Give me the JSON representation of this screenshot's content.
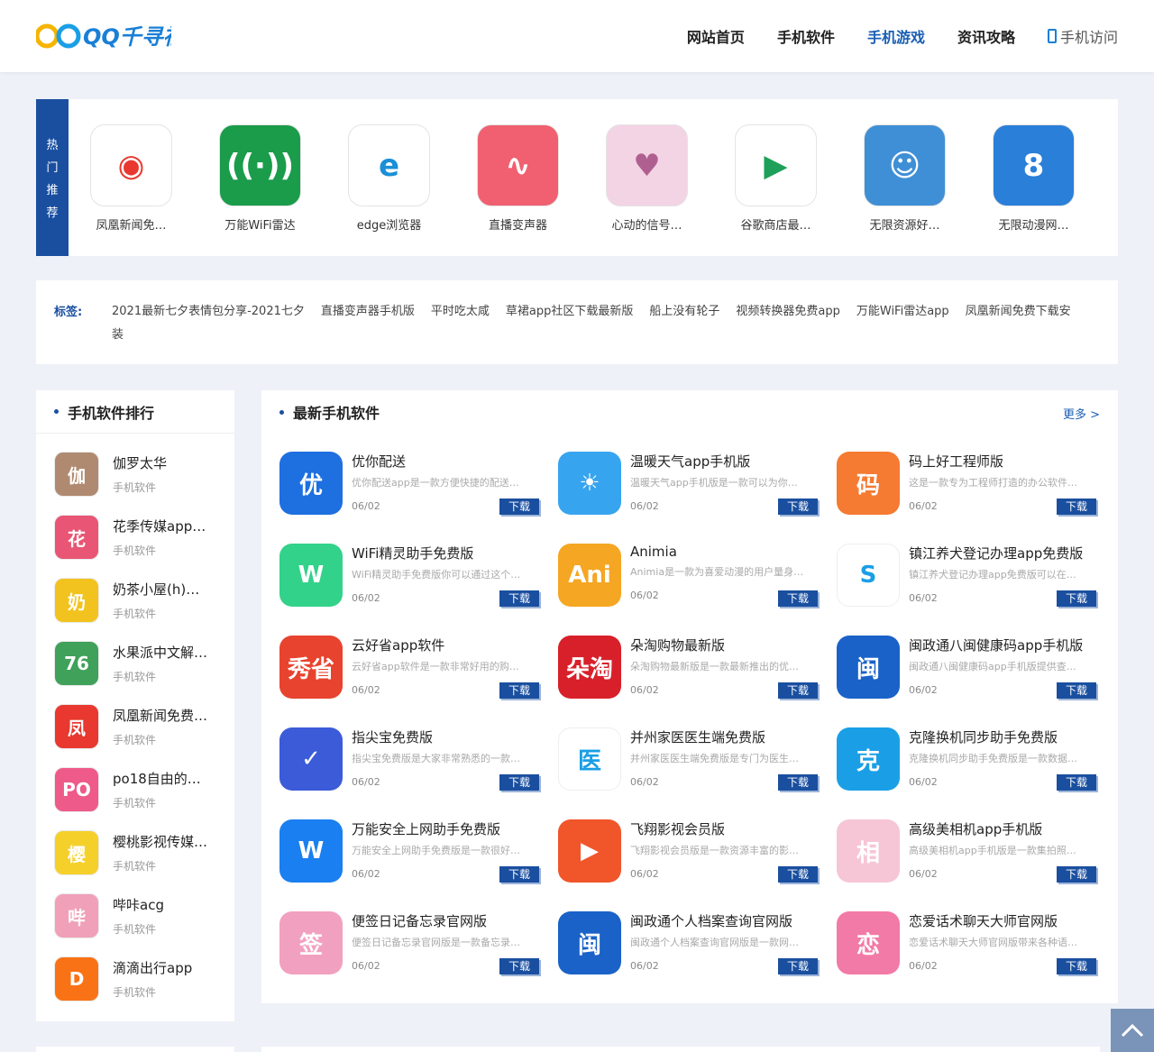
{
  "header": {
    "logo_text": "QQ千寻社区",
    "nav": [
      {
        "label": "网站首页"
      },
      {
        "label": "手机软件"
      },
      {
        "label": "手机游戏"
      },
      {
        "label": "资讯攻略"
      },
      {
        "label": "手机访问"
      }
    ]
  },
  "hot": {
    "label_chars": [
      "热",
      "门",
      "推",
      "荐"
    ],
    "items": [
      {
        "name": "凤凰新闻免…",
        "icon": "phoenix-icon",
        "color": "#ffffff"
      },
      {
        "name": "万能WiFi雷达",
        "icon": "wifi-icon",
        "color": "#1a9c4b"
      },
      {
        "name": "edge浏览器",
        "icon": "edge-icon",
        "color": "#ffffff"
      },
      {
        "name": "直播变声器",
        "icon": "voice-wave-icon",
        "color": "#f06070"
      },
      {
        "name": "心动的信号…",
        "icon": "heart-signal-icon",
        "color": "#f3d4e4"
      },
      {
        "name": "谷歌商店最…",
        "icon": "play-store-icon",
        "color": "#ffffff"
      },
      {
        "name": "无限资源好…",
        "icon": "couple-icon",
        "color": "#3f8fd6"
      },
      {
        "name": "无限动漫网…",
        "icon": "shield-8-icon",
        "color": "#2a7fd9"
      }
    ]
  },
  "tags": {
    "label": "标签:",
    "items": [
      "2021最新七夕表情包分享-2021七夕",
      "直播变声器手机版",
      "平时吃太咸",
      "草裙app社区下载最新版",
      "船上没有轮子",
      "视频转换器免费app",
      "万能WiFi雷达app",
      "凤凰新闻免费下载安装"
    ]
  },
  "rank": {
    "title": "手机软件排行",
    "items": [
      {
        "name": "伽罗太华",
        "cat": "手机软件",
        "color": "#b08a70",
        "glyph": "伽"
      },
      {
        "name": "花季传媒app…",
        "cat": "手机软件",
        "color": "#e95574",
        "glyph": "花"
      },
      {
        "name": "奶茶小屋(h)…",
        "cat": "手机软件",
        "color": "#f2c31e",
        "glyph": "奶"
      },
      {
        "name": "水果派中文解…",
        "cat": "手机软件",
        "color": "#3fa15a",
        "glyph": "76"
      },
      {
        "name": "凤凰新闻免费…",
        "cat": "手机软件",
        "color": "#e8382f",
        "glyph": "凤"
      },
      {
        "name": "po18自由的…",
        "cat": "手机软件",
        "color": "#ee5a8a",
        "glyph": "PO"
      },
      {
        "name": "樱桃影视传媒…",
        "cat": "手机软件",
        "color": "#f5d02a",
        "glyph": "樱"
      },
      {
        "name": "哔咔acg",
        "cat": "手机软件",
        "color": "#f0a0b8",
        "glyph": "哔"
      },
      {
        "name": "滴滴出行app",
        "cat": "手机软件",
        "color": "#f97316",
        "glyph": "D"
      }
    ]
  },
  "latest": {
    "title": "最新手机软件",
    "more": "更多 >",
    "download_label": "下载",
    "items": [
      {
        "name": "优你配送",
        "desc": "优你配送app是一款方便快捷的配送…",
        "date": "06/02",
        "color": "#1e6fe0",
        "glyph": "优"
      },
      {
        "name": "温暖天气app手机版",
        "desc": "温暖天气app手机版是一款可以为你…",
        "date": "06/02",
        "color": "#37a4f0",
        "glyph": "☀"
      },
      {
        "name": "码上好工程师版",
        "desc": "这是一款专为工程师打造的办公软件…",
        "date": "06/02",
        "color": "#f57a32",
        "glyph": "码"
      },
      {
        "name": "WiFi精灵助手免费版",
        "desc": "WiFi精灵助手免费版你可以通过这个…",
        "date": "06/02",
        "color": "#32d28a",
        "glyph": "W"
      },
      {
        "name": "Animia",
        "desc": "Animia是一款为喜爱动漫的用户量身…",
        "date": "06/02",
        "color": "#f5a623",
        "glyph": "Ani"
      },
      {
        "name": "镇江养犬登记办理app免费版",
        "desc": "镇江养犬登记办理app免费版可以在…",
        "date": "06/02",
        "color": "#ffffff",
        "glyph": "S"
      },
      {
        "name": "云好省app软件",
        "desc": "云好省app软件是一款非常好用的购…",
        "date": "06/02",
        "color": "#e8432e",
        "glyph": "秀省"
      },
      {
        "name": "朵淘购物最新版",
        "desc": "朵淘购物最新版是一款最新推出的优…",
        "date": "06/02",
        "color": "#d8202a",
        "glyph": "朵淘"
      },
      {
        "name": "闽政通八闽健康码app手机版",
        "desc": "闽政通八闽健康码app手机版提供查…",
        "date": "06/02",
        "color": "#1a62c8",
        "glyph": "闽"
      },
      {
        "name": "指尖宝免费版",
        "desc": "指尖宝免费版是大家非常熟悉的一款…",
        "date": "06/02",
        "color": "#3b5bd8",
        "glyph": "✓"
      },
      {
        "name": "并州家医医生端免费版",
        "desc": "并州家医医生端免费版是专门为医生…",
        "date": "06/02",
        "color": "#ffffff",
        "glyph": "医"
      },
      {
        "name": "克隆换机同步助手免费版",
        "desc": "克隆换机同步助手免费版是一款数据…",
        "date": "06/02",
        "color": "#1a9fe6",
        "glyph": "克"
      },
      {
        "name": "万能安全上网助手免费版",
        "desc": "万能安全上网助手免费版是一款很好…",
        "date": "06/02",
        "color": "#1a7ff0",
        "glyph": "W"
      },
      {
        "name": "飞翔影视会员版",
        "desc": "飞翔影视会员版是一款资源丰富的影…",
        "date": "06/02",
        "color": "#f0562a",
        "glyph": "▶"
      },
      {
        "name": "高级美相机app手机版",
        "desc": "高级美相机app手机版是一款集拍照…",
        "date": "06/02",
        "color": "#f6c6d6",
        "glyph": "相"
      },
      {
        "name": "便签日记备忘录官网版",
        "desc": "便签日记备忘录官网版是一款备忘录…",
        "date": "06/02",
        "color": "#f2a0c0",
        "glyph": "签"
      },
      {
        "name": "闽政通个人档案查询官网版",
        "desc": "闽政通个人档案查询官网版是一款网…",
        "date": "06/02",
        "color": "#1a62c8",
        "glyph": "闽"
      },
      {
        "name": "恋爱话术聊天大师官网版",
        "desc": "恋爱话术聊天大师官网版带来各种语…",
        "date": "06/02",
        "color": "#f27aa6",
        "glyph": "恋"
      }
    ]
  }
}
